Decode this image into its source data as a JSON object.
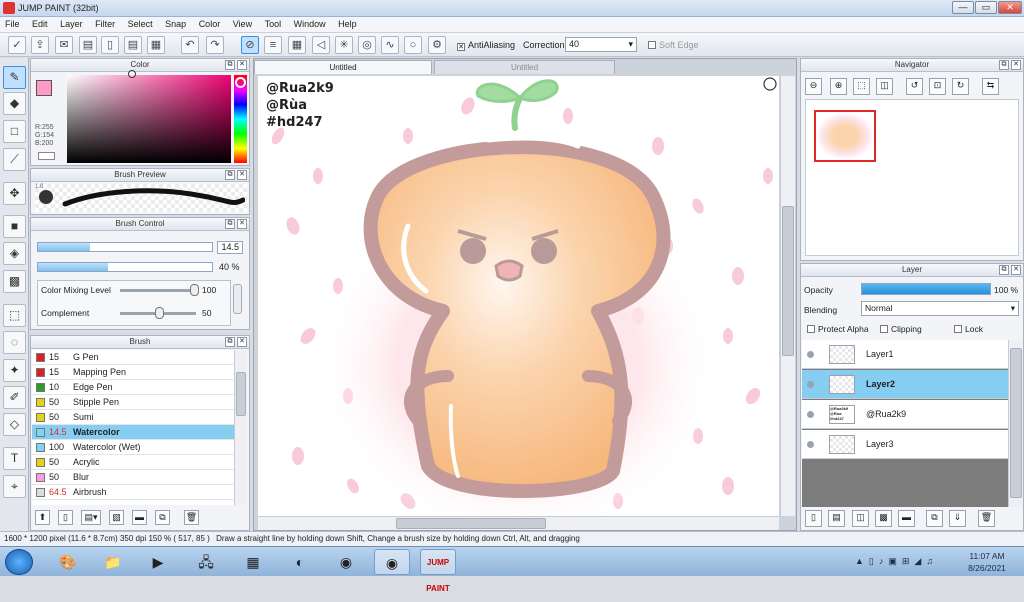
{
  "window": {
    "title": "JUMP PAINT (32bit)",
    "min": "—",
    "max": "▭",
    "close": "✕"
  },
  "menu": [
    "File",
    "Edit",
    "Layer",
    "Filter",
    "Select",
    "Snap",
    "Color",
    "View",
    "Tool",
    "Window",
    "Help"
  ],
  "toolbar": {
    "antialiasing_label": "AntiAliasing",
    "correction_label": "Correction",
    "correction_value": "40",
    "soft_edge_label": "Soft Edge"
  },
  "color_panel": {
    "title": "Color",
    "r": "R:255",
    "g": "G:154",
    "b": "B:200"
  },
  "brush_preview": {
    "title": "Brush Preview",
    "size": "1.0"
  },
  "brush_control": {
    "title": "Brush Control",
    "size_value": "14.5",
    "size_fill": 0.3,
    "density_value": "40 %",
    "density_fill": 0.4,
    "mixing_label": "Color Mixing Level",
    "mixing_value": "100",
    "mixing_level": 1.0,
    "complement_label": "Complement",
    "complement_value": "50",
    "complement_level": 0.5
  },
  "brush_panel": {
    "title": "Brush",
    "items": [
      {
        "value": "15",
        "name": "G Pen",
        "color": "#e02020"
      },
      {
        "value": "15",
        "name": "Mapping Pen",
        "color": "#e02020"
      },
      {
        "value": "10",
        "name": "Edge Pen",
        "color": "#2a9d2a"
      },
      {
        "value": "50",
        "name": "Stipple Pen",
        "color": "#e2d21a"
      },
      {
        "value": "50",
        "name": "Sumi",
        "color": "#e2d21a"
      },
      {
        "value": "14.5",
        "name": "Watercolor",
        "color": "#7fd3f5"
      },
      {
        "value": "100",
        "name": "Watercolor (Wet)",
        "color": "#7fd3f5"
      },
      {
        "value": "50",
        "name": "Acrylic",
        "color": "#e2d21a"
      },
      {
        "value": "50",
        "name": "Blur",
        "color": "#f4a0e0"
      },
      {
        "value": "64.5",
        "name": "Airbrush",
        "color": "#dcdcdc"
      }
    ],
    "selected": 5
  },
  "canvas": {
    "tab_active": "Untitled",
    "tab_inactive": "Untitled",
    "watermark": [
      "@Rua2k9",
      "@Rùa",
      "#hd247"
    ]
  },
  "navigator": {
    "title": "Navigator"
  },
  "layer_panel": {
    "title": "Layer",
    "opacity_label": "Opacity",
    "opacity_value": "100 %",
    "opacity_level": 1.0,
    "blending_label": "Blending",
    "blending_value": "Normal",
    "protect_alpha": "Protect Alpha",
    "clipping": "Clipping",
    "lock": "Lock",
    "layers": [
      "Layer1",
      "Layer2",
      "@Rua2k9",
      "Layer3"
    ],
    "selected": 1,
    "thumb_text": "@Rua2k9 @Rua #hd247"
  },
  "status": {
    "size": "1600 * 1200 pixel",
    "cm": "(11.6 * 8.7cm)",
    "dpi": "350 dpi",
    "zoom": "150 %",
    "coords": "( 517, 85 )",
    "hint": "Draw a straight line by holding down Shift, Change a brush size by holding down Ctrl, Alt, and dragging"
  },
  "taskbar": {
    "time": "11:07 AM",
    "date": "8/26/2021",
    "paint_label": "JUMP PAINT"
  },
  "colors": {
    "accent": "#86cdf2",
    "fg": "#ff9ac8",
    "paper_orange": "#f9c18e",
    "outline": "#c49b9b",
    "sprout": "#8fd28f"
  }
}
